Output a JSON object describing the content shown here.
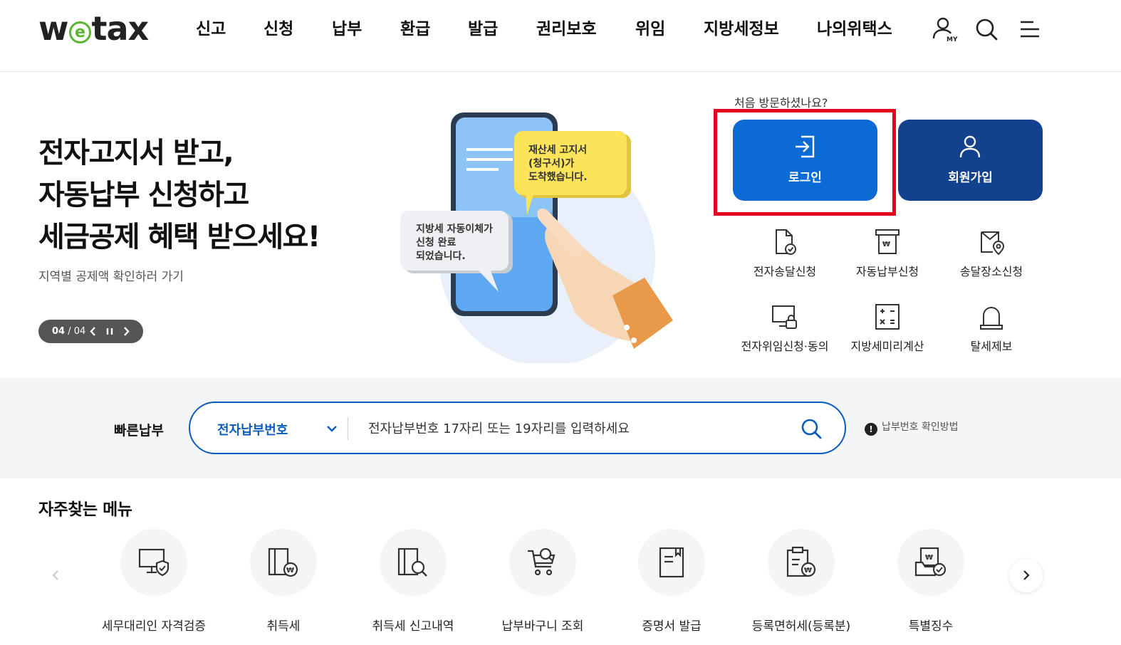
{
  "header": {
    "logo_pre": "w",
    "logo_e": "e",
    "logo_post": "tax",
    "nav": [
      "신고",
      "신청",
      "납부",
      "환급",
      "발급",
      "권리보호",
      "위임",
      "지방세정보",
      "나의위택스"
    ],
    "icons": [
      "my-user-icon",
      "search-icon",
      "menu-icon"
    ],
    "my_badge": "MY"
  },
  "hero": {
    "title_lines": [
      "전자고지서 받고,",
      "자동납부 신청하고",
      "세금공제 혜택 받으세요!"
    ],
    "sub": "지역별 공제액 확인하러 가기",
    "pager": {
      "current": "04",
      "sep": " / ",
      "total": "04"
    },
    "bubble1": [
      "재산세 고지서",
      "(청구서)가",
      "도착했습니다."
    ],
    "bubble2": [
      "지방세 자동이체가",
      "신청 완료",
      "되었습니다."
    ]
  },
  "account": {
    "first_visit": "처음 방문하셨나요?",
    "login": "로그인",
    "join": "회원가입",
    "quick": [
      "전자송달신청",
      "자동납부신청",
      "송달장소신청",
      "전자위임신청·동의",
      "지방세미리계산",
      "탈세제보"
    ]
  },
  "quickpay": {
    "label": "빠른납부",
    "select": "전자납부번호",
    "placeholder": "전자납부번호 17자리 또는 19자리를 입력하세요",
    "help": "납부번호 확인방법",
    "help_mark": "!"
  },
  "frequent": {
    "title": "자주찾는 메뉴",
    "items": [
      "세무대리인 자격검증",
      "취득세",
      "취득세 신고내역",
      "납부바구니 조회",
      "증명서 발급",
      "등록면허세(등록분)",
      "특별징수"
    ]
  },
  "colors": {
    "login": "#0b6ad4",
    "join": "#12418e",
    "highlight": "#e8001e",
    "logo_green": "#5cb531"
  }
}
